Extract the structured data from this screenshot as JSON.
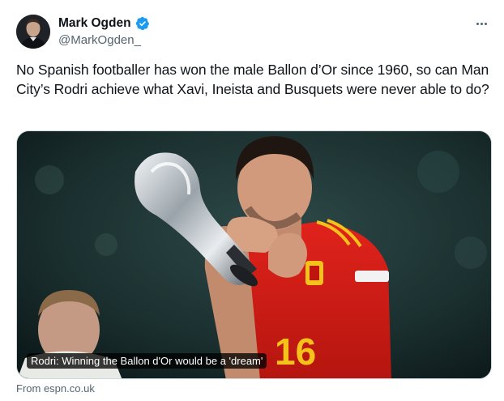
{
  "author": {
    "display_name": "Mark Ogden",
    "handle": "@MarkOgden_",
    "verified": true
  },
  "tweet": {
    "text": "No Spanish footballer has won the male Ballon d’Or since 1960, so can Man City’s Rodri achieve what Xavi, Ineista and Busquets were never able to do?"
  },
  "card": {
    "caption": "Rodri: Winning the Ballon d'Or would be a 'dream'",
    "source": "From espn.co.uk"
  },
  "colors": {
    "verified_blue": "#1d9bf0",
    "text_primary": "#0f1419",
    "text_secondary": "#536471",
    "border": "#cfd9de"
  },
  "icons": {
    "verified": "verified-badge-icon",
    "more": "more-options-icon"
  }
}
